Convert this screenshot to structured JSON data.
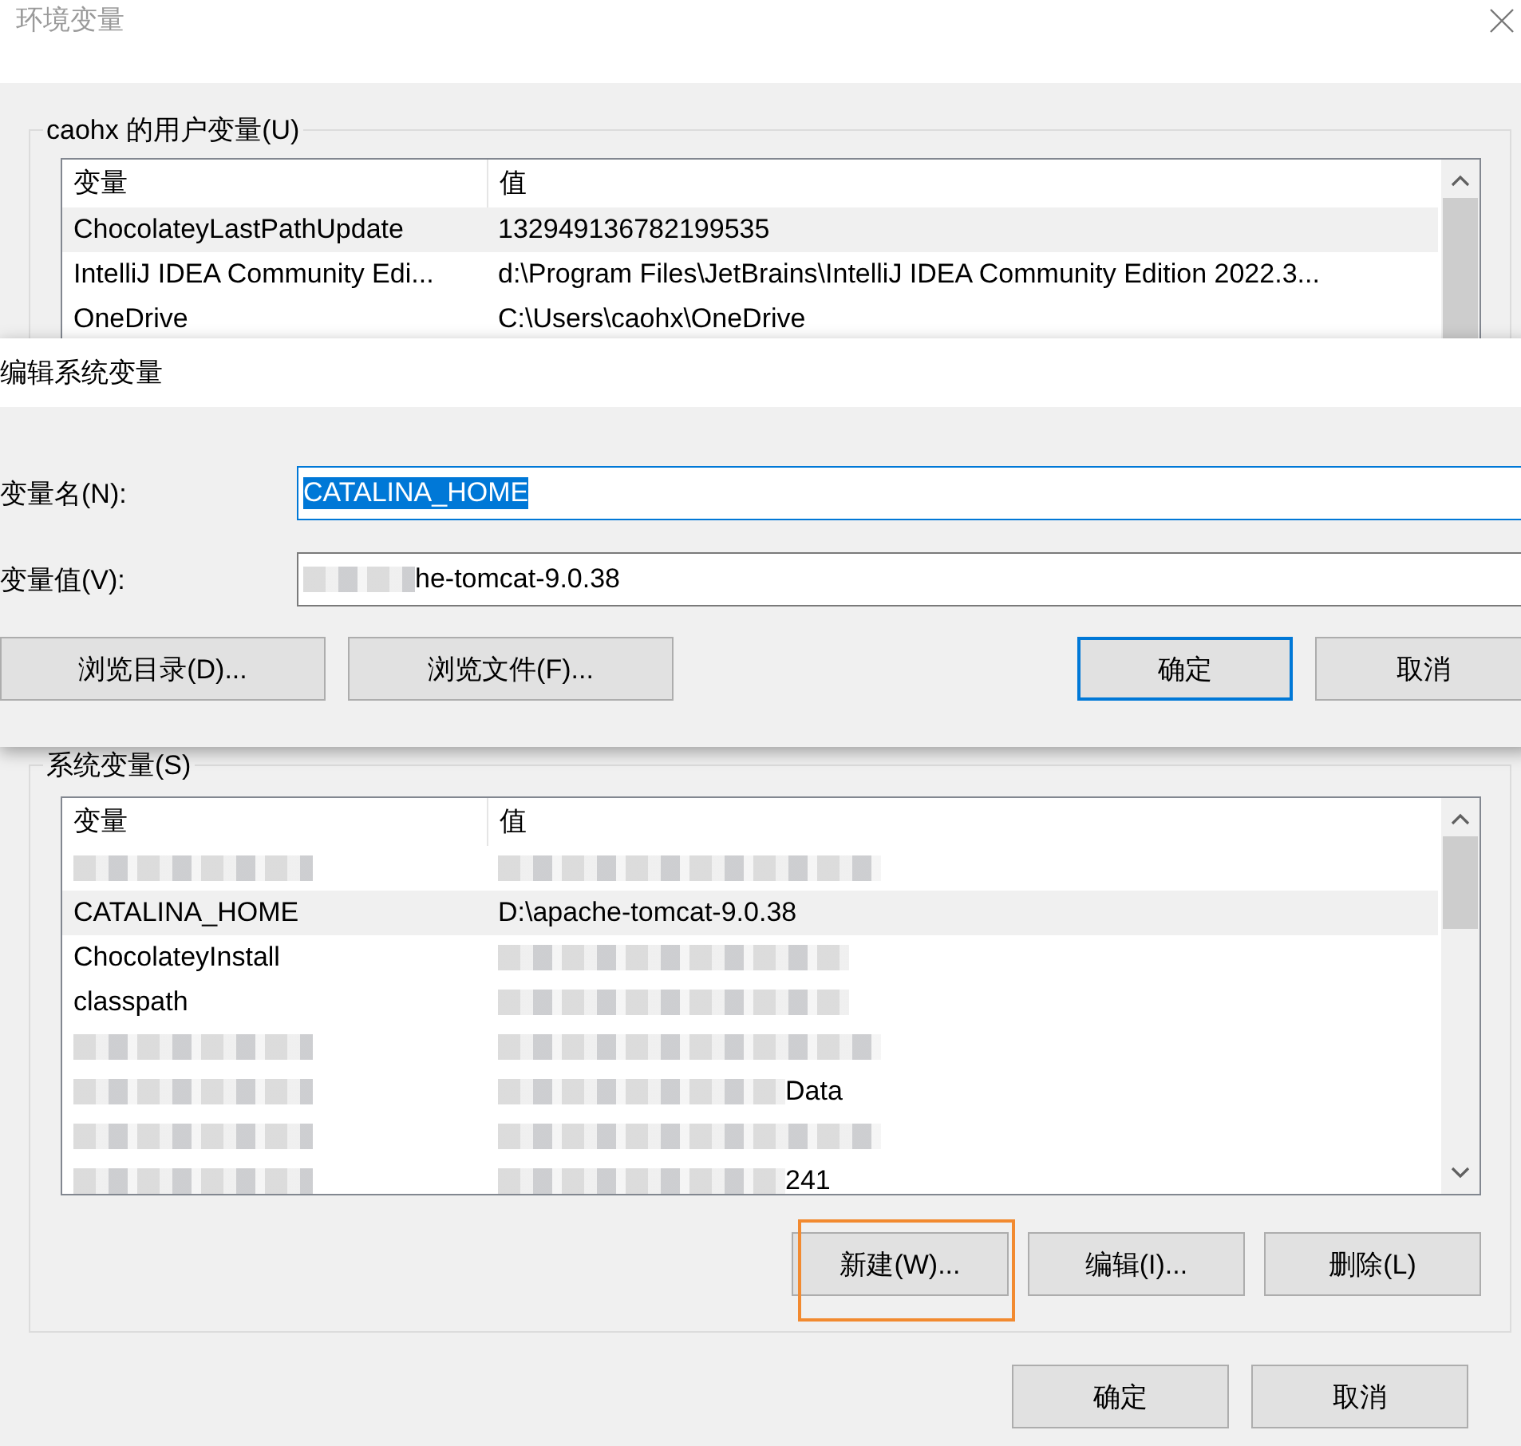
{
  "window": {
    "title": "环境变量"
  },
  "user_vars": {
    "label": "caohx 的用户变量(U)",
    "columns": [
      "变量",
      "值"
    ],
    "rows": [
      {
        "name": "ChocolateyLastPathUpdate",
        "value": "132949136782199535",
        "selected": true
      },
      {
        "name": "IntelliJ IDEA Community Edi...",
        "value": "d:\\Program Files\\JetBrains\\IntelliJ IDEA Community Edition 2022.3...",
        "selected": false
      },
      {
        "name": "OneDrive",
        "value": "C:\\Users\\caohx\\OneDrive",
        "selected": false
      }
    ]
  },
  "system_vars": {
    "label": "系统变量(S)",
    "columns": [
      "变量",
      "值"
    ],
    "rows": [
      {
        "selected": false
      },
      {
        "name": "CATALINA_HOME",
        "value": "D:\\apache-tomcat-9.0.38",
        "selected": true
      },
      {
        "name": "ChocolateyInstall",
        "selected": false
      },
      {
        "name": "classpath",
        "selected": false
      },
      {
        "selected": false
      },
      {
        "value": "Data",
        "selected": false
      },
      {
        "selected": false
      },
      {
        "value": "241",
        "selected": false
      }
    ],
    "buttons": [
      {
        "label": "新建(W)...",
        "highlighted": true
      },
      {
        "label": "编辑(I)...",
        "highlighted": false
      },
      {
        "label": "删除(L)",
        "highlighted": false
      }
    ]
  },
  "buttons": [
    {
      "label": "确定",
      "default": false
    },
    {
      "label": "取消",
      "default": false
    }
  ],
  "edit_dialog": {
    "title": "编辑系统变量",
    "fields": [
      {
        "label": "变量名(N):",
        "value": "CATALINA_HOME",
        "text_selected": true
      },
      {
        "label": "变量值(V):",
        "value": "he-tomcat-9.0.38",
        "text_selected": false
      }
    ],
    "left_buttons": [
      "浏览目录(D)...",
      "浏览文件(F)..."
    ],
    "buttons": [
      {
        "label": "确定",
        "default": true
      },
      {
        "label": "取消",
        "default": false
      }
    ]
  }
}
